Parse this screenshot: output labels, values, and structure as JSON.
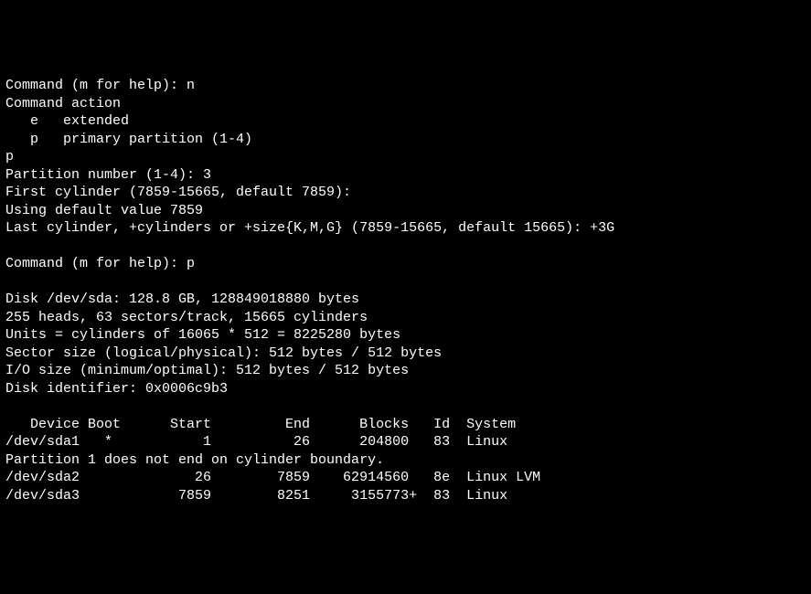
{
  "lines": {
    "l1": "Command (m for help): n",
    "l2": "Command action",
    "l3": "   e   extended",
    "l4": "   p   primary partition (1-4)",
    "l5": "p",
    "l6": "Partition number (1-4): 3",
    "l7": "First cylinder (7859-15665, default 7859):",
    "l8": "Using default value 7859",
    "l9": "Last cylinder, +cylinders or +size{K,M,G} (7859-15665, default 15665): +3G",
    "l10": "",
    "l11": "Command (m for help): p",
    "l12": "",
    "l13": "Disk /dev/sda: 128.8 GB, 128849018880 bytes",
    "l14": "255 heads, 63 sectors/track, 15665 cylinders",
    "l15": "Units = cylinders of 16065 * 512 = 8225280 bytes",
    "l16": "Sector size (logical/physical): 512 bytes / 512 bytes",
    "l17": "I/O size (minimum/optimal): 512 bytes / 512 bytes",
    "l18": "Disk identifier: 0x0006c9b3",
    "l19": "",
    "l20": "   Device Boot      Start         End      Blocks   Id  System",
    "l21": "/dev/sda1   *           1          26      204800   83  Linux",
    "l22": "Partition 1 does not end on cylinder boundary.",
    "l23": "/dev/sda2              26        7859    62914560   8e  Linux LVM",
    "l24": "/dev/sda3            7859        8251     3155773+  83  Linux"
  }
}
